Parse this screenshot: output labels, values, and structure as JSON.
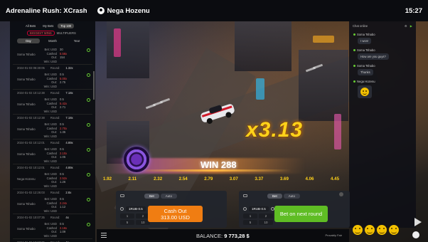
{
  "header": {
    "title": "Adrenaline Rush: XCrash",
    "user": "Nega Hozenu",
    "clock": "15:27"
  },
  "left_panel": {
    "tabs": [
      "All Bets",
      "My Bets",
      "Top 100"
    ],
    "active_tab": 2,
    "subtabs": [
      "BIGGEST WINS",
      "MULTIPLIERS"
    ],
    "periods": [
      "Day",
      "Month",
      "Year"
    ],
    "active_period": 0,
    "labels": {
      "bet": "Bet: USD",
      "cashed": "Cashed Out:",
      "win": "Win: USD",
      "round": "Round:"
    },
    "records": [
      {
        "name": "Soma Tshabo",
        "bet": "30",
        "cashed": "5.58x",
        "win": "154",
        "date": "2024-01-03 06:30:05",
        "round": "1.32x"
      },
      {
        "name": "Soma Tshabo",
        "bet": "0.5",
        "cashed": "5.00x",
        "win": "2.75",
        "date": "2024-01-02 10:12:38",
        "round": "7.18x"
      },
      {
        "name": "Soma Tshabo",
        "bet": "0.5",
        "cashed": "5.42x",
        "win": "2.71",
        "date": "2024-01-02 10:12:38",
        "round": "7.18x"
      },
      {
        "name": "Soma Tshabo",
        "bet": "0.5",
        "cashed": "2.70x",
        "win": "1.35",
        "date": "2024-01-02 10:12:01",
        "round": "4.89x"
      },
      {
        "name": "Soma Tshabo",
        "bet": "0.5",
        "cashed": "2.10x",
        "win": "1.05",
        "date": "2024-01-02 10:12:01",
        "round": "4.89x"
      },
      {
        "name": "Nega Hozenu",
        "bet": "0.5",
        "cashed": "2.52x",
        "win": "1.26",
        "date": "2024-01-02 12:26:03",
        "round": "2.8x"
      },
      {
        "name": "Soma Tshabo",
        "bet": "0.5",
        "cashed": "2.24x",
        "win": "1.12",
        "date": "2024-01-02 10:07:35",
        "round": "4x"
      },
      {
        "name": "Soma Tshabo",
        "bet": "0.5",
        "cashed": "2.18x",
        "win": "1.09",
        "date": "2024-01-02 10:07:35",
        "round": "4x"
      }
    ]
  },
  "chat": {
    "header": "Chat online",
    "messages": [
      {
        "user": "Soma Tshabo",
        "text": "I won!"
      },
      {
        "user": "Soma Tshabo",
        "text": "How are you guys?"
      },
      {
        "user": "Soma Tshabo",
        "text": "Thanks"
      },
      {
        "user": "Nega Hozenu",
        "text": ""
      }
    ]
  },
  "game": {
    "multiplier": "x3.13",
    "win_text": "WIN 288",
    "scale": [
      "1.92",
      "2.11",
      "2.32",
      "2.54",
      "2.79",
      "3.07",
      "3.37",
      "3.69",
      "4.06",
      "4.45"
    ]
  },
  "bet_panels": [
    {
      "toggle": [
        "Bet",
        "Auto"
      ],
      "active": 0,
      "amount": "1RUB·0.5",
      "chips": [
        "1",
        "2",
        "5",
        "10"
      ],
      "button_line1": "Cash Out",
      "button_line2": "313.00 USD",
      "button_color": "#f07d12"
    },
    {
      "toggle": [
        "Bet",
        "Auto"
      ],
      "active": 0,
      "amount": "1RUB·0.5",
      "chips": [
        "1",
        "2",
        "5",
        "10"
      ],
      "button_line1": "Bet on next round",
      "button_line2": "",
      "button_color": "#5fbd24"
    }
  ],
  "footer": {
    "balance_label": "BALANCE:",
    "balance_value": "9 773,28 $",
    "provably_fair": "Provably Fair"
  }
}
